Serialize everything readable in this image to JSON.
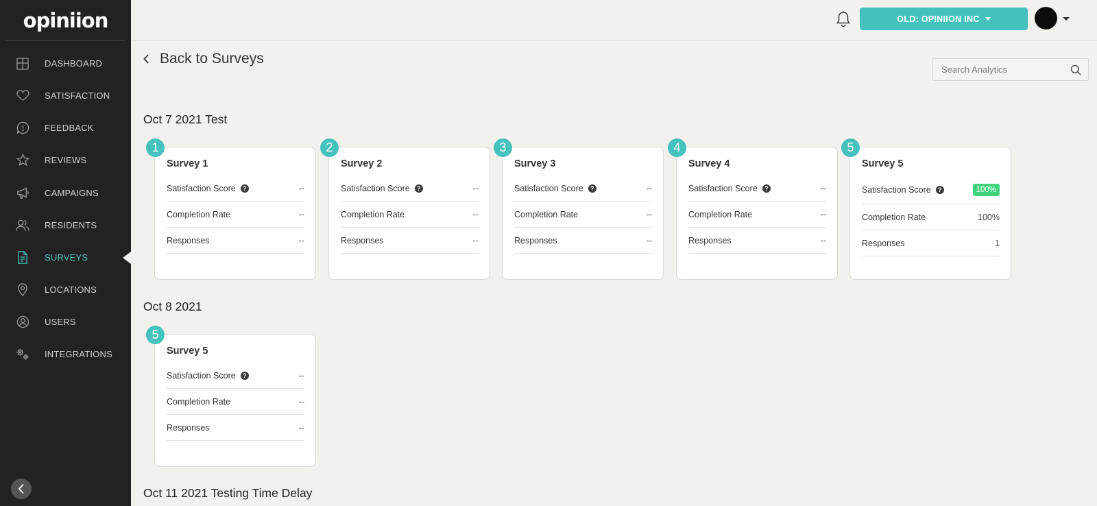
{
  "app": {
    "logo": "opiniion"
  },
  "sidebar": {
    "items": [
      {
        "label": "DASHBOARD",
        "icon": "dashboard-icon"
      },
      {
        "label": "SATISFACTION",
        "icon": "heart-icon"
      },
      {
        "label": "FEEDBACK",
        "icon": "feedback-icon"
      },
      {
        "label": "REVIEWS",
        "icon": "star-icon"
      },
      {
        "label": "CAMPAIGNS",
        "icon": "megaphone-icon"
      },
      {
        "label": "RESIDENTS",
        "icon": "residents-icon"
      },
      {
        "label": "SURVEYS",
        "icon": "document-icon"
      },
      {
        "label": "LOCATIONS",
        "icon": "location-pin-icon"
      },
      {
        "label": "USERS",
        "icon": "user-icon"
      },
      {
        "label": "INTEGRATIONS",
        "icon": "gears-icon"
      }
    ],
    "active": "SURVEYS"
  },
  "topbar": {
    "org_label": "OLD: OPINIION INC"
  },
  "back": {
    "label": "Back to Surveys"
  },
  "search": {
    "placeholder": "Search Analytics"
  },
  "colors": {
    "accent": "#45c1be",
    "sidebar_bg": "#222222",
    "success": "#3fd47c"
  },
  "sections": [
    {
      "title": "Oct 7 2021 Test",
      "cards": [
        {
          "num": "1",
          "title": "Survey 1",
          "rows": [
            {
              "label": "Satisfaction Score",
              "value": "--"
            },
            {
              "label": "Completion Rate",
              "value": "--"
            },
            {
              "label": "Responses",
              "value": "--"
            }
          ]
        },
        {
          "num": "2",
          "title": "Survey 2",
          "rows": [
            {
              "label": "Satisfaction Score",
              "value": "--"
            },
            {
              "label": "Completion Rate",
              "value": "--"
            },
            {
              "label": "Responses",
              "value": "--"
            }
          ]
        },
        {
          "num": "3",
          "title": "Survey 3",
          "rows": [
            {
              "label": "Satisfaction Score",
              "value": "--"
            },
            {
              "label": "Completion Rate",
              "value": "--"
            },
            {
              "label": "Responses",
              "value": "--"
            }
          ]
        },
        {
          "num": "4",
          "title": "Survey 4",
          "rows": [
            {
              "label": "Satisfaction Score",
              "value": "--"
            },
            {
              "label": "Completion Rate",
              "value": "--"
            },
            {
              "label": "Responses",
              "value": "--"
            }
          ]
        },
        {
          "num": "5",
          "title": "Survey 5",
          "rows": [
            {
              "label": "Satisfaction Score",
              "value": "100%"
            },
            {
              "label": "Completion Rate",
              "value": "100%"
            },
            {
              "label": "Responses",
              "value": "1"
            }
          ]
        }
      ]
    },
    {
      "title": "Oct 8 2021",
      "cards": [
        {
          "num": "5",
          "title": "Survey 5",
          "rows": [
            {
              "label": "Satisfaction Score",
              "value": "--"
            },
            {
              "label": "Completion Rate",
              "value": "--"
            },
            {
              "label": "Responses",
              "value": "--"
            }
          ]
        }
      ]
    },
    {
      "title": "Oct 11 2021 Testing Time Delay"
    }
  ]
}
